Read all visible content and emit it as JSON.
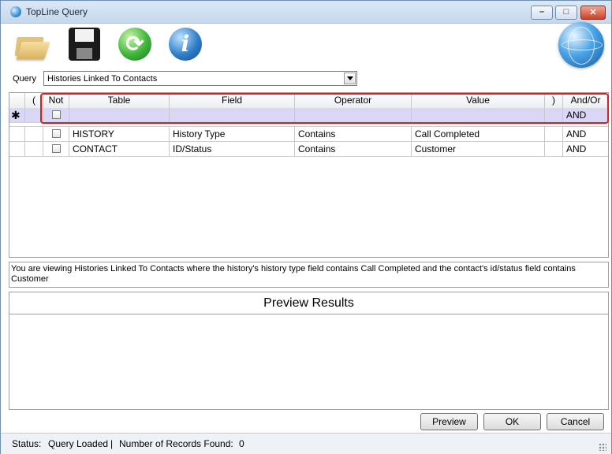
{
  "window": {
    "title": "TopLine Query",
    "controls": {
      "minimize": "–",
      "maximize": "□",
      "close": "✕"
    }
  },
  "toolbar": {
    "icons": [
      "folder-open-icon",
      "save-icon",
      "refresh-icon",
      "info-icon",
      "globe-icon"
    ]
  },
  "query": {
    "label": "Query",
    "selected": "Histories Linked To Contacts"
  },
  "grid": {
    "columns": [
      "(",
      "Not",
      "Table",
      "Field",
      "Operator",
      "Value",
      ")",
      "And/Or"
    ],
    "new_row": {
      "marker": "✱",
      "and_or": "AND"
    },
    "rows": [
      {
        "open": "",
        "not": false,
        "table": "HISTORY",
        "field": "History Type",
        "operator": "Contains",
        "value": "Call Completed",
        "close": "",
        "and_or": "AND"
      },
      {
        "open": "",
        "not": false,
        "table": "CONTACT",
        "field": "ID/Status",
        "operator": "Contains",
        "value": "Customer",
        "close": "",
        "and_or": "AND"
      }
    ]
  },
  "description": "You are viewing Histories Linked To Contacts where the history's history type field contains Call Completed and the contact's id/status field contains Customer",
  "preview": {
    "title": "Preview Results"
  },
  "buttons": {
    "preview": "Preview",
    "ok": "OK",
    "cancel": "Cancel"
  },
  "status": {
    "label": "Status:",
    "value": "Query Loaded",
    "sep": "|",
    "records_label": "Number of Records Found:",
    "records_count": "0"
  },
  "colors": {
    "highlight": "#e01b1b",
    "new_row_bg": "#d8d8f6"
  }
}
